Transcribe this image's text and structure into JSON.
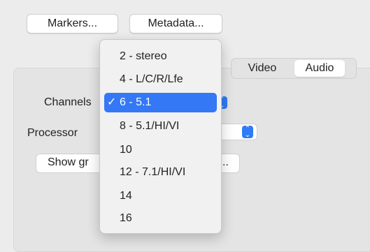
{
  "toolbar": {
    "markers_label": "Markers...",
    "metadata_label": "Metadata..."
  },
  "tabs": [
    {
      "label": "Video"
    },
    {
      "label": "Audio",
      "selected": true
    }
  ],
  "form": {
    "channels_label": "Channels",
    "processor_label": "Processor",
    "show_button_label": "Show gr",
    "show_button_suffix": ".."
  },
  "channels_menu": {
    "items": [
      {
        "label": "2 - stereo",
        "check": ""
      },
      {
        "label": "4 - L/C/R/Lfe",
        "check": ""
      },
      {
        "label": "6 - 5.1",
        "check": "✓",
        "selected": true
      },
      {
        "label": "8 - 5.1/HI/VI",
        "check": ""
      },
      {
        "label": "10",
        "check": ""
      },
      {
        "label": "12 - 7.1/HI/VI",
        "check": ""
      },
      {
        "label": "14",
        "check": ""
      },
      {
        "label": "16",
        "check": ""
      }
    ]
  },
  "colors": {
    "accent": "#3478f6",
    "background": "#ececec"
  },
  "icons": {
    "stepper": "chevron-up-down-icon",
    "check": "checkmark-icon"
  }
}
